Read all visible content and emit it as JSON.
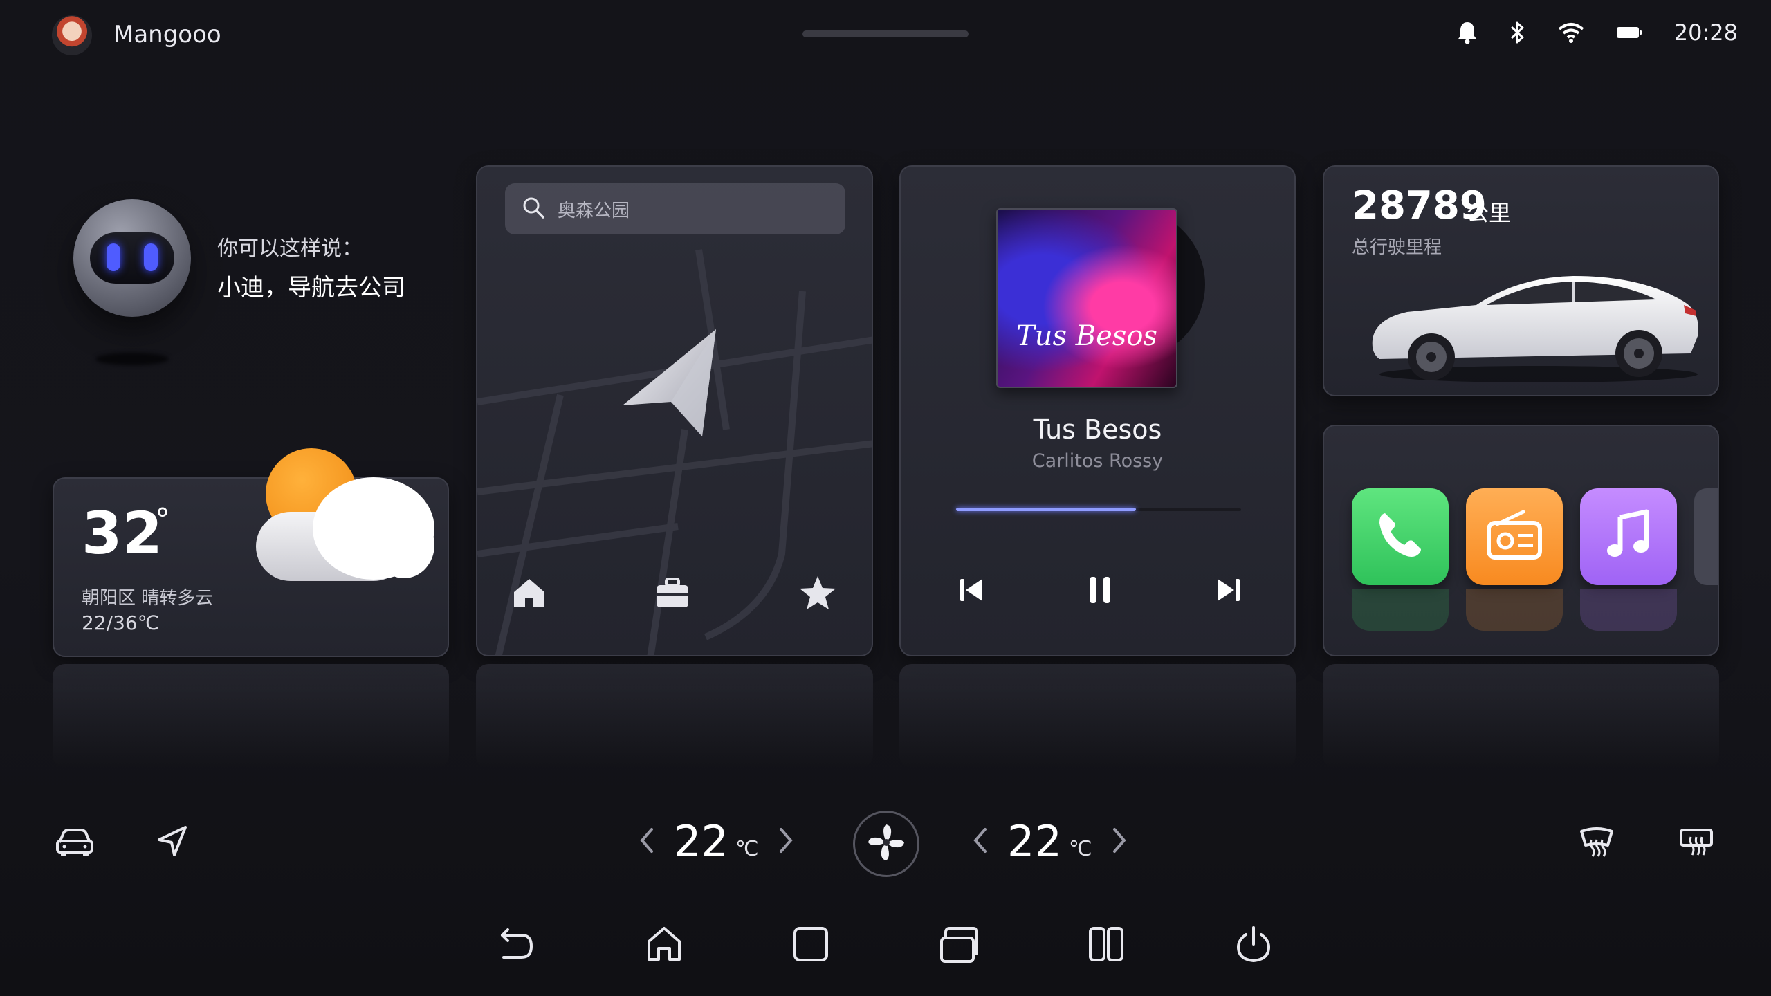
{
  "status_bar": {
    "user_name": "Mangooo",
    "time": "20:28",
    "icons": [
      "bell-icon",
      "bluetooth-icon",
      "wifi-icon",
      "battery-icon"
    ]
  },
  "assistant": {
    "hint": "你可以这样说：",
    "command": "小迪，导航去公司"
  },
  "weather": {
    "temperature": "32",
    "degree": "°",
    "description": "朝阳区 晴转多云",
    "range": "22/36℃",
    "icon": "partly-cloudy-icon"
  },
  "navigation": {
    "search_placeholder": "奥森公园",
    "shortcuts": [
      "home-icon",
      "briefcase-icon",
      "star-icon"
    ]
  },
  "music": {
    "cover_text": "Tus Besos",
    "song_title": "Tus Besos",
    "artist": "Carlitos Rossy",
    "progress": 0.63,
    "controls": [
      "previous-icon",
      "pause-icon",
      "next-icon"
    ]
  },
  "vehicle": {
    "odometer": "28789",
    "unit": "公里",
    "label": "总行驶里程"
  },
  "apps": {
    "items": [
      "phone",
      "radio",
      "music"
    ],
    "colors": {
      "phone": "#3fd36a",
      "radio": "#ff9a3a",
      "music": "#b57bff"
    }
  },
  "climate": {
    "left_temp": "22",
    "right_temp": "22",
    "unit": "℃"
  },
  "colors": {
    "accent": "#8f9cff",
    "background": "#141419"
  }
}
